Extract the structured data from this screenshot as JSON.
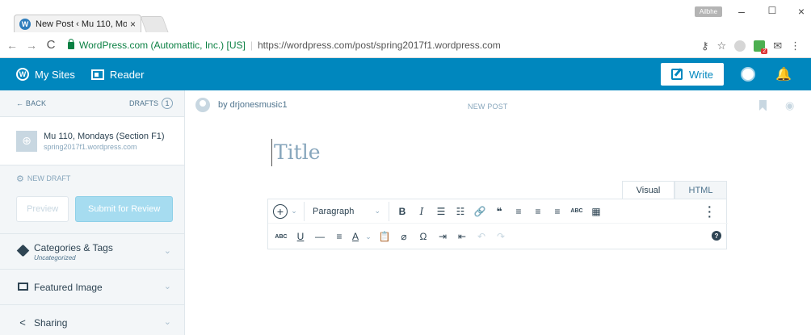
{
  "browser": {
    "tab_title": "New Post ‹ Mu 110, Mon",
    "tab_close": "×",
    "tab_favicon": "W",
    "profile_name": "Ailbhe",
    "window_controls": {
      "minimize": "–",
      "maximize": "☐",
      "close": "×"
    },
    "nav": {
      "back": "←",
      "forward": "→",
      "reload": "C"
    },
    "ev_cert": "WordPress.com (Automattic, Inc.) [US]",
    "url": "https://wordpress.com/post/spring2017f1.wordpress.com",
    "extension_badge": "2"
  },
  "masterbar": {
    "my_sites": "My Sites",
    "reader": "Reader",
    "write": "Write",
    "logo_glyph": "W",
    "color": "#0087be"
  },
  "sidebar": {
    "back": "← BACK",
    "drafts_label": "DRAFTS",
    "drafts_count": "1",
    "site_name": "Mu 110, Mondays (Section F1)",
    "site_url": "spring2017f1.wordpress.com",
    "new_draft": "NEW DRAFT",
    "preview": "Preview",
    "submit": "Submit for Review",
    "sections": [
      {
        "title": "Categories & Tags",
        "subtitle": "Uncategorized",
        "icon": "tag-icon"
      },
      {
        "title": "Featured Image",
        "icon": "image-icon"
      },
      {
        "title": "Sharing",
        "icon": "share-icon"
      }
    ]
  },
  "editor": {
    "author": "by drjonesmusic1",
    "status": "NEW POST",
    "title_placeholder": "Title",
    "tabs": [
      "Visual",
      "HTML"
    ],
    "format_select": "Paragraph",
    "toolbar_row1": [
      "B",
      "I",
      "☰",
      "☷",
      "🔗",
      "❝",
      "≡",
      "≡",
      "≡",
      "ABC",
      "▦"
    ],
    "toolbar_row2": [
      "ABC",
      "U",
      "—",
      "≡",
      "A",
      "📋",
      "⌀",
      "Ω",
      "⇥",
      "⇤",
      "↶",
      "↷"
    ]
  }
}
